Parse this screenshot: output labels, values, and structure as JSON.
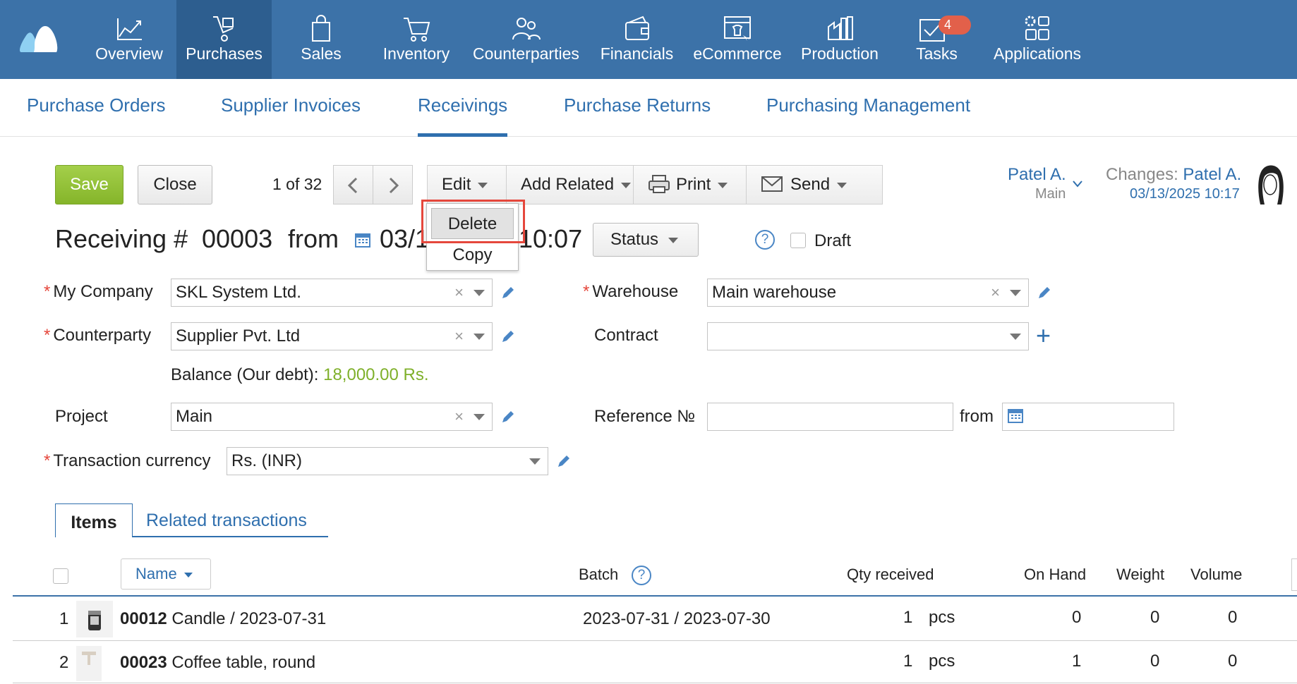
{
  "nav": {
    "items": [
      {
        "label": "Overview",
        "icon": "chart-line-icon"
      },
      {
        "label": "Purchases",
        "icon": "cart-hand-icon",
        "active": true
      },
      {
        "label": "Sales",
        "icon": "shopping-bag-icon"
      },
      {
        "label": "Inventory",
        "icon": "cart-icon"
      },
      {
        "label": "Counterparties",
        "icon": "people-icon"
      },
      {
        "label": "Financials",
        "icon": "wallet-icon"
      },
      {
        "label": "eCommerce",
        "icon": "store-icon"
      },
      {
        "label": "Production",
        "icon": "factory-icon"
      },
      {
        "label": "Tasks",
        "icon": "tasks-check-icon",
        "badge": "4"
      },
      {
        "label": "Applications",
        "icon": "apps-grid-icon"
      }
    ]
  },
  "subnav": {
    "tabs": [
      {
        "label": "Purchase Orders"
      },
      {
        "label": "Supplier Invoices"
      },
      {
        "label": "Receivings",
        "active": true
      },
      {
        "label": "Purchase Returns"
      },
      {
        "label": "Purchasing Management"
      }
    ]
  },
  "toolbar": {
    "save": "Save",
    "close": "Close",
    "pager": "1 of 32",
    "edit": "Edit",
    "add_related": "Add Related",
    "print": "Print",
    "send": "Send"
  },
  "dropdown": {
    "delete": "Delete",
    "copy": "Copy"
  },
  "user": {
    "name": "Patel A.",
    "sub": "Main",
    "changes_label": "Changes:",
    "changes_user": "Patel A.",
    "changes_date": "03/13/2025 10:17"
  },
  "heading": {
    "title": "Receiving #",
    "number": "00003",
    "from": "from",
    "date_left": "03/1",
    "date_right": "10:07",
    "status": "Status",
    "help": "?",
    "draft": "Draft"
  },
  "form": {
    "my_company_label": "My Company",
    "my_company_value": "SKL System Ltd.",
    "warehouse_label": "Warehouse",
    "warehouse_value": "Main warehouse",
    "counterparty_label": "Counterparty",
    "counterparty_value": "Supplier Pvt. Ltd",
    "contract_label": "Contract",
    "contract_value": "",
    "balance_label": "Balance (Our debt):",
    "balance_value": "18,000.00 Rs.",
    "project_label": "Project",
    "project_value": "Main",
    "reference_label": "Reference №",
    "reference_value": "",
    "ref_from": "from",
    "currency_label": "Transaction currency",
    "currency_value": "Rs. (INR)",
    "clear_glyph": "×"
  },
  "tabs": {
    "items": "Items",
    "related": "Related transactions"
  },
  "table": {
    "headers": {
      "name": "Name",
      "batch": "Batch",
      "qty": "Qty received",
      "on_hand": "On Hand",
      "weight": "Weight",
      "volume": "Volume"
    },
    "rows": [
      {
        "idx": "1",
        "code": "00012",
        "name": "Candle / 2023-07-31",
        "batch": "2023-07-31 / 2023-07-30",
        "qty": "1",
        "unit": "pcs",
        "on_hand": "0",
        "weight": "0",
        "volume": "0"
      },
      {
        "idx": "2",
        "code": "00023",
        "name": "Coffee table, round",
        "batch": "",
        "qty": "1",
        "unit": "pcs",
        "on_hand": "1",
        "weight": "0",
        "volume": "0"
      }
    ]
  },
  "colors": {
    "nav_bg": "#3c72a8",
    "nav_active": "#2d5e8f",
    "accent": "#2f6fae",
    "save_green": "#8fbf33",
    "balance_green": "#7fb02a",
    "highlight_red": "#e5473c"
  }
}
